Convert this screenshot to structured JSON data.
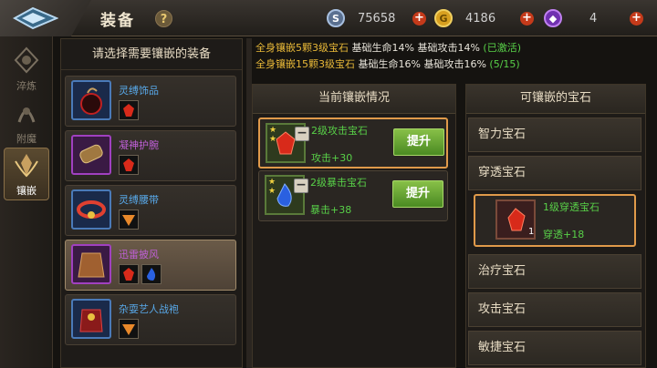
{
  "header": {
    "title": "装备",
    "help": "?"
  },
  "resources": [
    {
      "icon": "silver-coin-icon",
      "value": "75658",
      "color": "#8aa0c0"
    },
    {
      "icon": "gold-coin-icon",
      "value": "4186",
      "color": "#d8a020"
    },
    {
      "icon": "purple-gem-icon",
      "value": "4",
      "color": "#9048d0"
    }
  ],
  "side_tabs": [
    {
      "label": "淬炼",
      "icon": "forge-icon"
    },
    {
      "label": "附魔",
      "icon": "enchant-icon"
    },
    {
      "label": "镶嵌",
      "icon": "inlay-icon",
      "active": true
    }
  ],
  "equipment": {
    "heading": "请选择需要镶嵌的装备",
    "items": [
      {
        "name": "灵缚饰品",
        "name_color": "#58a8e8",
        "frame": "blue",
        "gems": [
          "red"
        ]
      },
      {
        "name": "凝神护腕",
        "name_color": "#c060d8",
        "frame": "purple",
        "gems": [
          "red"
        ]
      },
      {
        "name": "灵缚腰带",
        "name_color": "#58a8e8",
        "frame": "blue",
        "gems": [
          "orange"
        ]
      },
      {
        "name": "迅雷披风",
        "name_color": "#c060d8",
        "frame": "purple",
        "gems": [
          "red",
          "blue"
        ],
        "selected": true
      },
      {
        "name": "杂耍艺人战袍",
        "name_color": "#58a8e8",
        "frame": "blue",
        "gems": [
          "orange"
        ]
      }
    ]
  },
  "bonuses": [
    {
      "prefix": "全身镶嵌5颗3级宝石",
      "stats": "基础生命14% 基础攻击14%",
      "status": "(已激活)"
    },
    {
      "prefix": "全身镶嵌15颗3级宝石",
      "stats": "基础生命16% 基础攻击16%",
      "status": "(5/15)"
    }
  ],
  "current_inlay": {
    "heading": "当前镶嵌情况",
    "gems": [
      {
        "name": "2级攻击宝石",
        "stat": "攻击+30",
        "button": "提升",
        "gem": "red",
        "selected": true
      },
      {
        "name": "2级暴击宝石",
        "stat": "暴击+38",
        "button": "提升",
        "gem": "blue"
      }
    ]
  },
  "available_gems": {
    "heading": "可镶嵌的宝石",
    "categories": [
      "智力宝石",
      "穿透宝石",
      "治疗宝石",
      "攻击宝石",
      "敏捷宝石"
    ],
    "expanded": {
      "name": "1级穿透宝石",
      "stat": "穿透+18",
      "count": "1"
    }
  }
}
